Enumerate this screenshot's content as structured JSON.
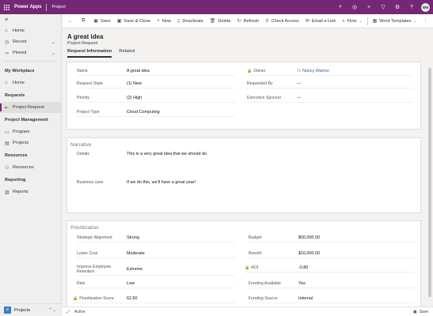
{
  "topbar": {
    "app_name": "Power Apps",
    "environment": "Project",
    "icons": [
      "search-icon",
      "task-icon",
      "add-icon",
      "filter-icon",
      "settings-icon",
      "help-icon"
    ],
    "avatar_initials": "NW"
  },
  "sidebar": {
    "items_top": [
      {
        "label": "Home",
        "icon": "home-icon"
      },
      {
        "label": "Recent",
        "icon": "clock-icon",
        "chevron": "⌄"
      },
      {
        "label": "Pinned",
        "icon": "pin-icon",
        "chevron": "⌄"
      }
    ],
    "groups": [
      {
        "title": "My Workplace",
        "items": [
          {
            "label": "Home",
            "icon": "home-icon"
          }
        ]
      },
      {
        "title": "Requests",
        "items": [
          {
            "label": "Project Request",
            "icon": "request-icon"
          }
        ]
      },
      {
        "title": "Project Management",
        "items": [
          {
            "label": "Program",
            "icon": "program-icon"
          },
          {
            "label": "Projects",
            "icon": "projects-icon"
          }
        ]
      },
      {
        "title": "Resources",
        "items": [
          {
            "label": "Resources",
            "icon": "resources-icon"
          }
        ]
      },
      {
        "title": "Reporting",
        "items": [
          {
            "label": "Reports",
            "icon": "reports-icon"
          }
        ]
      }
    ],
    "area": {
      "badge": "P",
      "label": "Projects",
      "chevron": "⌃⌄"
    }
  },
  "commands": {
    "save": "Save",
    "save_close": "Save & Close",
    "new": "New",
    "deactivate": "Deactivate",
    "delete": "Delete",
    "refresh": "Refresh",
    "check_access": "Check Access",
    "email_link": "Email a Link",
    "flow": "Flow",
    "word_templates": "Word Templates",
    "more": "⋮"
  },
  "record": {
    "title": "A great idea",
    "subtitle": "Project Request",
    "tabs": [
      "Request Information",
      "Related"
    ]
  },
  "general": {
    "name_label": "Name",
    "name_value": "A great idea",
    "state_label": "Request State",
    "state_value": "(1) New",
    "priority_label": "Priority",
    "priority_value": "(2) High",
    "type_label": "Project Type",
    "type_value": "Cloud Computing",
    "owner_label": "Owner",
    "owner_value": "Nancy Warner",
    "requested_by_label": "Requested By",
    "requested_by_value": "---",
    "sponsor_label": "Executive Sponsor",
    "sponsor_value": "---"
  },
  "narrative": {
    "title": "Narrative",
    "details_label": "Details",
    "details_value": "This is a very great idea that we should do.",
    "business_case_label": "Business case",
    "business_case_value": "If we do this, we'll have a great year!"
  },
  "prioritization": {
    "title": "Prioritization",
    "strategic_label": "Strategic Alignment",
    "strategic_value": "Strong",
    "lower_cost_label": "Lower Cost",
    "lower_cost_value": "Moderate",
    "improve_label": "Improve Employee Retention",
    "improve_value": "Extreme",
    "risk_label": "Risk",
    "risk_value": "Low",
    "score_label": "Prioritization Score",
    "score_value": "62.50",
    "budget_label": "Budget",
    "budget_value": "$50,000.00",
    "benefit_label": "Benefit",
    "benefit_value": "$10,000.00",
    "roi_label": "ROI",
    "roi_value": "-0.80",
    "funding_available_label": "Funding Available",
    "funding_available_value": "Yes",
    "funding_source_label": "Funding Source",
    "funding_source_value": "Internal"
  },
  "footer": {
    "status": "Active",
    "save": "Save"
  }
}
